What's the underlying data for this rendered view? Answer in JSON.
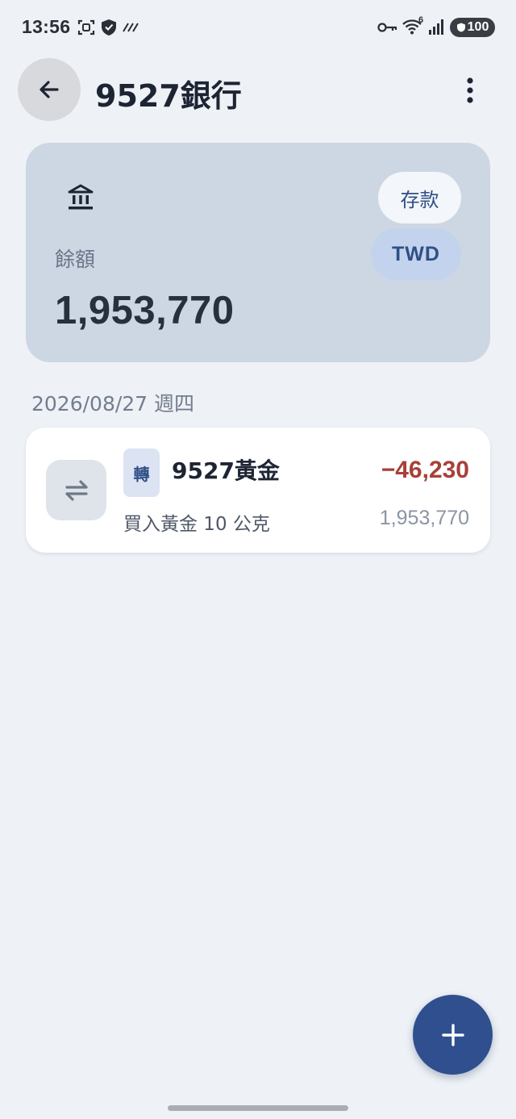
{
  "status_bar": {
    "time": "13:56",
    "icons": [
      "screenshot-icon",
      "shield-icon",
      "signal-lines-icon",
      "key-icon",
      "wifi-icon",
      "cell-signal-icon"
    ],
    "wifi_badge": "6",
    "battery": "100"
  },
  "header": {
    "back_icon": "arrow-left-icon",
    "title": "9527銀行",
    "menu_icon": "more-vert-icon"
  },
  "account": {
    "icon": "bank-icon",
    "type_label": "存款",
    "currency": "TWD",
    "balance_label": "餘額",
    "balance": "1,953,770",
    "card_color": "#cdd7e3"
  },
  "transactions": {
    "date": "2026/08/27 週四",
    "items": [
      {
        "icon": "transfer-icon",
        "tag": "轉",
        "name": "9527黃金",
        "note": "買入黃金 10 公克",
        "amount": "−46,230",
        "balance_after": "1,953,770",
        "amount_color": "#a7403a"
      }
    ]
  },
  "fab": {
    "icon": "plus-icon",
    "color": "#2f4f8e"
  }
}
